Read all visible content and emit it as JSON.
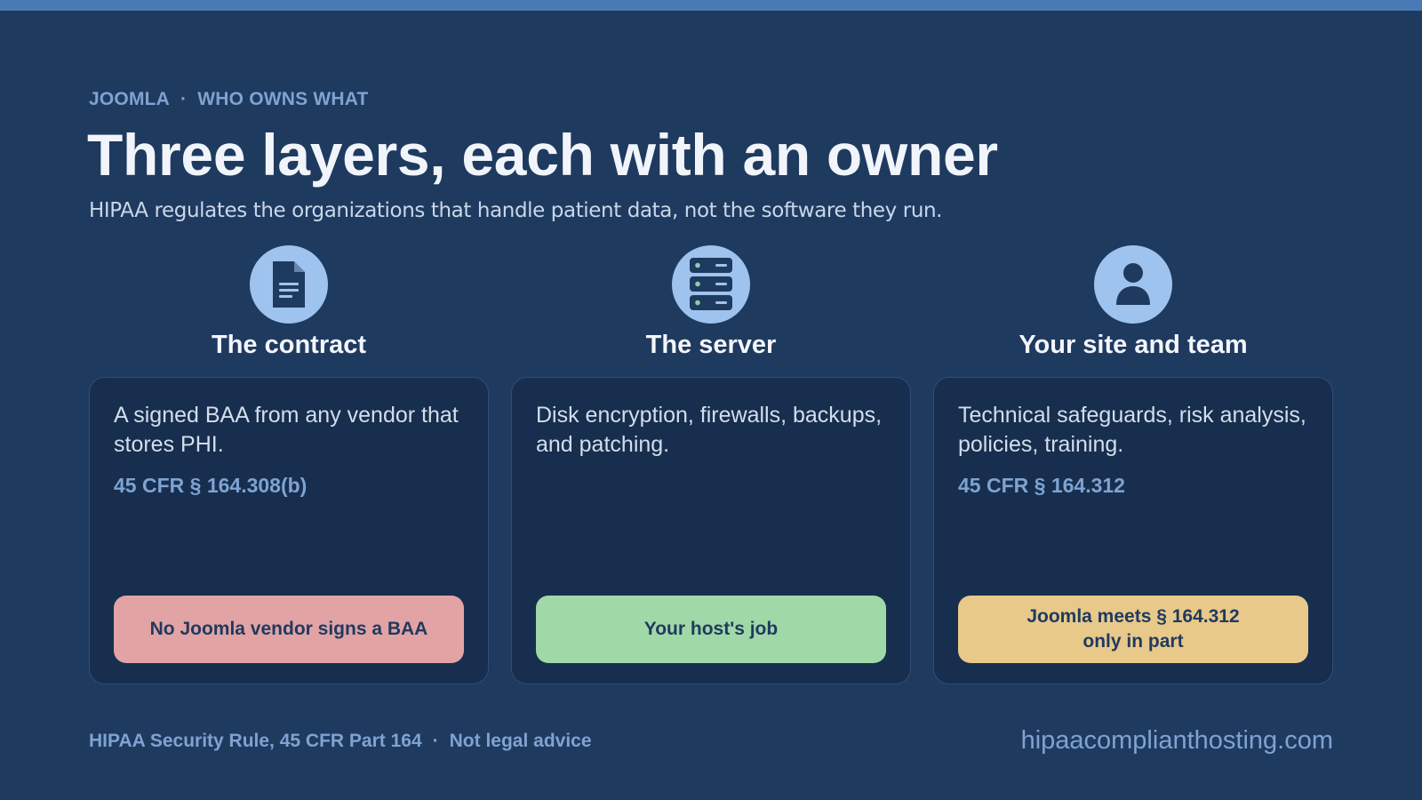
{
  "header": {
    "eyebrow_left": "JOOMLA",
    "eyebrow_separator": "·",
    "eyebrow_right": "WHO OWNS WHAT",
    "title": "Three layers, each with an owner",
    "subtitle": "HIPAA regulates the organizations that handle patient data, not the software they run."
  },
  "columns": [
    {
      "icon": "document-icon",
      "title": "The contract",
      "description": "A signed BAA from any vendor that stores PHI.",
      "citation": "45 CFR § 164.308(b)",
      "status": "No Joomla vendor signs a BAA",
      "status_color": "#e2a3a5"
    },
    {
      "icon": "server-icon",
      "title": "The server",
      "description": "Disk encryption, firewalls, backups, and patching.",
      "citation": "",
      "status": "Your host's job",
      "status_color": "#a0d8a7"
    },
    {
      "icon": "user-icon",
      "title": "Your site and team",
      "description": "Technical safeguards, risk analysis, policies, training.",
      "citation": "45 CFR § 164.312",
      "status_line1": "Joomla meets § 164.312",
      "status_line2": "only in part",
      "status_color": "#e8c98a"
    }
  ],
  "footer": {
    "source": "HIPAA Security Rule, 45 CFR Part 164",
    "separator": "·",
    "disclaimer": "Not legal advice",
    "site": "hipaacomplianthosting.com"
  },
  "colors": {
    "background": "#1f3a5f",
    "accent_bar": "#4a7ab5",
    "card": "#172e4e",
    "muted_text": "#7ea3d1",
    "icon_circle": "#9ec3ee"
  }
}
